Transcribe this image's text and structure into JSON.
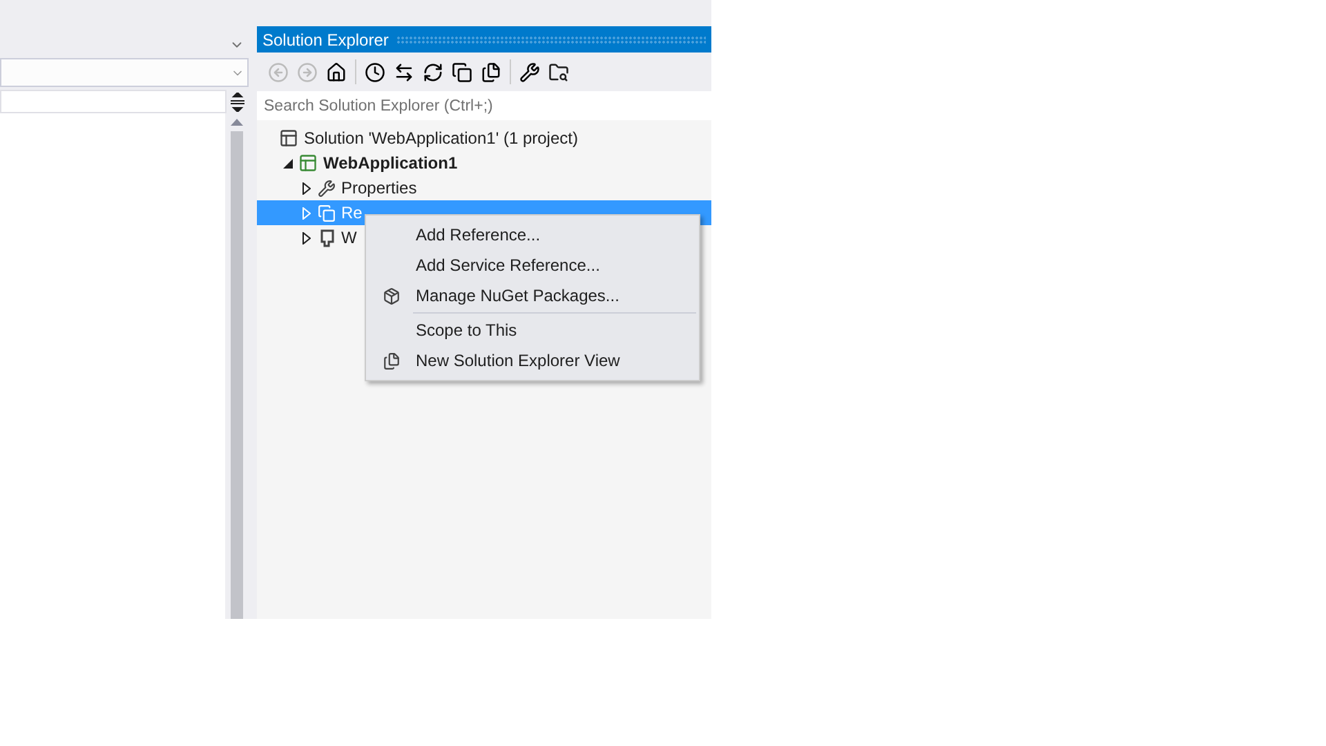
{
  "solution_explorer": {
    "title": "Solution Explorer",
    "search": {
      "placeholder": "Search Solution Explorer (Ctrl+;)"
    },
    "tree": [
      {
        "kind": "solution",
        "label": "Solution 'WebApplication1' (1 project)",
        "selected": false,
        "children": [
          {
            "kind": "project",
            "label": "WebApplication1",
            "selected": false,
            "expanded": true,
            "children": [
              {
                "kind": "properties",
                "label": "Properties",
                "selected": false,
                "expanded": false
              },
              {
                "kind": "references",
                "label": "Re",
                "selected": true,
                "expanded": false
              },
              {
                "kind": "webref",
                "label": "W",
                "selected": false,
                "expanded": false
              }
            ]
          }
        ]
      }
    ]
  },
  "context_menu": [
    {
      "kind": "plain",
      "label": "Add Reference..."
    },
    {
      "kind": "plain",
      "label": "Add Service Reference..."
    },
    {
      "kind": "package",
      "label": "Manage NuGet Packages..."
    },
    {
      "kind": "separator"
    },
    {
      "kind": "plain",
      "label": "Scope to This"
    },
    {
      "kind": "view",
      "label": "New Solution Explorer View"
    }
  ]
}
